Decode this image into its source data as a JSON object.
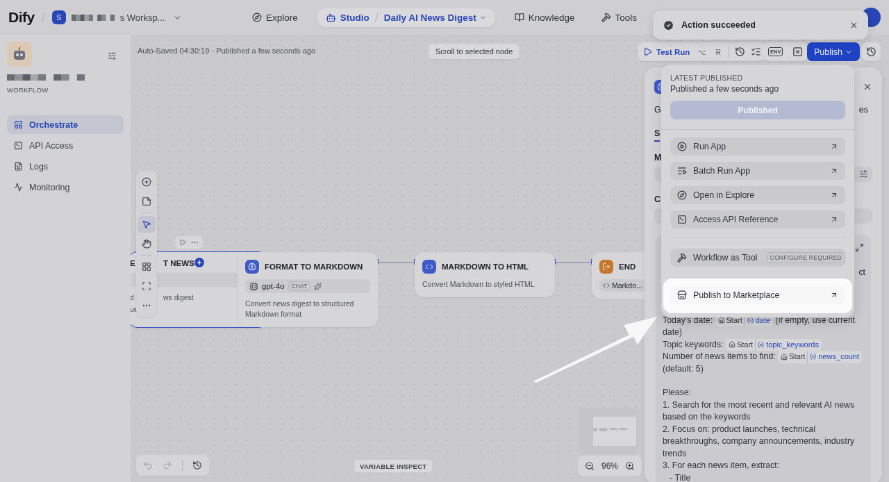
{
  "topbar": {
    "logo": "Dify",
    "workspace": {
      "initial": "S",
      "name": "s Worksp..."
    },
    "nav": [
      {
        "kind": "explore",
        "label": "Explore",
        "selected": false
      },
      {
        "kind": "studio",
        "label": "Studio",
        "app": "Daily AI News Digest",
        "selected": true
      },
      {
        "kind": "knowledge",
        "label": "Knowledge",
        "selected": false
      },
      {
        "kind": "tools",
        "label": "Tools",
        "selected": false
      }
    ]
  },
  "toast": {
    "message": "Action succeeded"
  },
  "sidebar": {
    "app_type": "WORKFLOW",
    "items": [
      {
        "kind": "orchestrate",
        "label": "Orchestrate",
        "selected": true
      },
      {
        "kind": "api",
        "label": "API Access",
        "selected": false
      },
      {
        "kind": "logs",
        "label": "Logs",
        "selected": false
      },
      {
        "kind": "monitoring",
        "label": "Monitoring",
        "selected": false
      }
    ]
  },
  "canvas": {
    "status": "Auto-Saved 04:30:19 · Published a few seconds ago",
    "scroll_button": "Scroll to selected node",
    "test_run": {
      "label": "Test Run",
      "keys": [
        "⌥",
        "R"
      ]
    },
    "env_label": "ENV",
    "publish_button": "Publish",
    "tools": [
      {
        "kind": "add",
        "selected": false
      },
      {
        "kind": "note",
        "selected": false
      },
      {
        "kind": "pointer",
        "selected": true
      },
      {
        "kind": "hand",
        "selected": false
      },
      {
        "kind": "organize",
        "selected": false
      },
      {
        "kind": "frame",
        "selected": false
      },
      {
        "kind": "more",
        "selected": false
      }
    ],
    "nodes": [
      {
        "kind": "llm",
        "selected": true,
        "title_parts": [
          "E",
          "T NEWS"
        ],
        "description_lines": [
          [
            "d",
            "ws digest"
          ],
          [
            "ue"
          ]
        ]
      },
      {
        "kind": "llm",
        "selected": false,
        "title": "FORMAT TO MARKDOWN",
        "model": "gpt-4o",
        "mode": "CHAT",
        "description": "Convert news digest to structured Markdown format"
      },
      {
        "kind": "code",
        "selected": false,
        "title": "MARKDOWN TO HTML",
        "description": "Convert Markdown to styled HTML"
      },
      {
        "kind": "end",
        "selected": false,
        "title": "END",
        "output": "Markdo..."
      }
    ],
    "variable_inspect": "VARIABLE INSPECT",
    "zoom": "96%"
  },
  "publish_menu": {
    "heading": "LATEST PUBLISHED",
    "time": "Published a few seconds ago",
    "button": {
      "label": "Published",
      "disabled": true
    },
    "items": [
      {
        "kind": "run",
        "label": "Run App",
        "highlighted": false
      },
      {
        "kind": "batch",
        "label": "Batch Run App",
        "highlighted": false
      },
      {
        "kind": "explore",
        "label": "Open in Explore",
        "highlighted": false
      },
      {
        "kind": "api",
        "label": "Access API Reference",
        "highlighted": false
      },
      {
        "kind": "tool",
        "label": "Workflow as Tool",
        "badge": "CONFIGURE REQUIRED",
        "highlighted": false
      },
      {
        "kind": "marketplace",
        "label": "Publish to Marketplace",
        "highlighted": true
      }
    ]
  },
  "panel": {
    "row_fragments": [
      "G",
      "es"
    ],
    "tab_fragment": "S",
    "label_fragments": [
      "M",
      "C"
    ],
    "prompt_fragment": "ct",
    "prompt": [
      {
        "gap_before": false,
        "segments": [
          {
            "kind": "text",
            "text": "Today's date:"
          },
          {
            "kind": "var",
            "node": "Start",
            "name": "date"
          },
          {
            "kind": "text",
            "text": "(if empty, use current"
          },
          {
            "kind": "text",
            "text": "date)"
          }
        ]
      },
      {
        "gap_before": false,
        "segments": [
          {
            "kind": "text",
            "text": "Topic keywords:"
          },
          {
            "kind": "var",
            "node": "Start",
            "name": "topic_keywords"
          }
        ]
      },
      {
        "gap_before": false,
        "segments": [
          {
            "kind": "text",
            "text": "Number of news items to find:"
          },
          {
            "kind": "var",
            "node": "Start",
            "name": "news_count"
          },
          {
            "kind": "text",
            "text": "(default: 5)"
          }
        ]
      },
      {
        "gap_before": true,
        "segments": [
          {
            "kind": "text",
            "text": "Please:"
          }
        ]
      },
      {
        "gap_before": false,
        "segments": [
          {
            "kind": "text",
            "text": "1. Search for the most recent and relevant AI news based on the keywords"
          }
        ]
      },
      {
        "gap_before": false,
        "segments": [
          {
            "kind": "text",
            "text": "2. Focus on: product launches, technical breakthroughs, company announcements, industry trends"
          }
        ]
      },
      {
        "gap_before": false,
        "segments": [
          {
            "kind": "text",
            "text": "3. For each news item, extract:"
          }
        ]
      },
      {
        "gap_before": false,
        "segments": [
          {
            "kind": "text",
            "text": "   - Title"
          }
        ]
      }
    ]
  }
}
